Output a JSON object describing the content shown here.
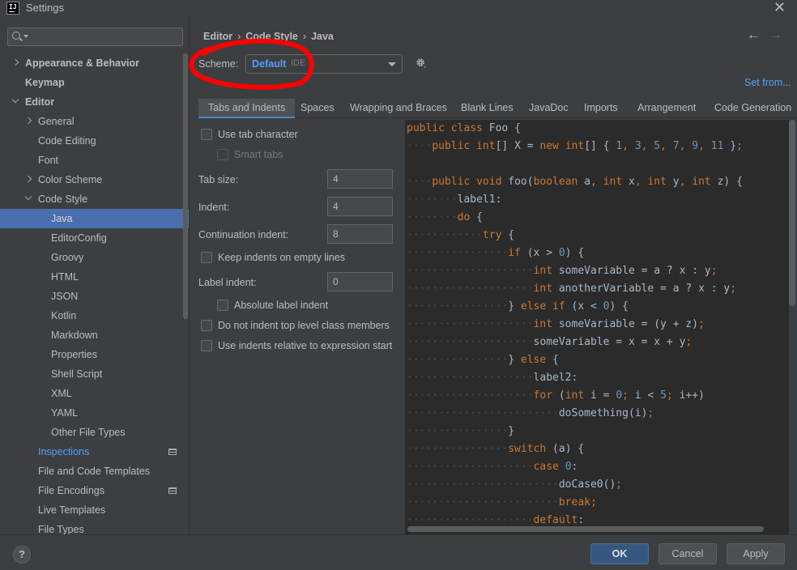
{
  "window": {
    "title": "Settings",
    "app_icon_text": "IJ"
  },
  "sidebar": {
    "search_placeholder": "",
    "items": [
      {
        "label": "Appearance & Behavior",
        "level": 0,
        "expand": "collapsed",
        "bold": true
      },
      {
        "label": "Keymap",
        "level": 0,
        "expand": "none",
        "bold": true
      },
      {
        "label": "Editor",
        "level": 0,
        "expand": "expanded",
        "bold": true
      },
      {
        "label": "General",
        "level": 1,
        "expand": "collapsed"
      },
      {
        "label": "Code Editing",
        "level": 1,
        "expand": "none"
      },
      {
        "label": "Font",
        "level": 1,
        "expand": "none"
      },
      {
        "label": "Color Scheme",
        "level": 1,
        "expand": "collapsed"
      },
      {
        "label": "Code Style",
        "level": 1,
        "expand": "expanded"
      },
      {
        "label": "Java",
        "level": 2,
        "expand": "none",
        "selected": true
      },
      {
        "label": "EditorConfig",
        "level": 2,
        "expand": "none"
      },
      {
        "label": "Groovy",
        "level": 2,
        "expand": "none"
      },
      {
        "label": "HTML",
        "level": 2,
        "expand": "none"
      },
      {
        "label": "JSON",
        "level": 2,
        "expand": "none"
      },
      {
        "label": "Kotlin",
        "level": 2,
        "expand": "none"
      },
      {
        "label": "Markdown",
        "level": 2,
        "expand": "none"
      },
      {
        "label": "Properties",
        "level": 2,
        "expand": "none"
      },
      {
        "label": "Shell Script",
        "level": 2,
        "expand": "none"
      },
      {
        "label": "XML",
        "level": 2,
        "expand": "none"
      },
      {
        "label": "YAML",
        "level": 2,
        "expand": "none"
      },
      {
        "label": "Other File Types",
        "level": 2,
        "expand": "none"
      },
      {
        "label": "Inspections",
        "level": 1,
        "expand": "none",
        "link": true,
        "project_icon": true
      },
      {
        "label": "File and Code Templates",
        "level": 1,
        "expand": "none"
      },
      {
        "label": "File Encodings",
        "level": 1,
        "expand": "none",
        "project_icon": true
      },
      {
        "label": "Live Templates",
        "level": 1,
        "expand": "none"
      },
      {
        "label": "File Types",
        "level": 1,
        "expand": "none"
      }
    ]
  },
  "header": {
    "breadcrumb": [
      "Editor",
      "Code Style",
      "Java"
    ],
    "scheme_label": "Scheme:",
    "scheme_value": "Default",
    "scheme_suffix": "IDE",
    "set_from": "Set from..."
  },
  "tabs": [
    "Tabs and Indents",
    "Spaces",
    "Wrapping and Braces",
    "Blank Lines",
    "JavaDoc",
    "Imports",
    "Arrangement",
    "Code Generation"
  ],
  "options": {
    "use_tab_character": "Use tab character",
    "smart_tabs": "Smart tabs",
    "tab_size_label": "Tab size:",
    "tab_size": "4",
    "indent_label": "Indent:",
    "indent": "4",
    "continuation_indent_label": "Continuation indent:",
    "continuation_indent": "8",
    "keep_indents": "Keep indents on empty lines",
    "label_indent_label": "Label indent:",
    "label_indent": "0",
    "absolute_label_indent": "Absolute label indent",
    "no_indent_top_level": "Do not indent top level class members",
    "relative_indents": "Use indents relative to expression start"
  },
  "code_lines": [
    "public class Foo {",
    "    public int[] X = new int[] { 1, 3, 5, 7, 9, 11 };",
    "",
    "    public void foo(boolean a, int x, int y, int z) {",
    "        label1:",
    "        do {",
    "            try {",
    "                if (x > 0) {",
    "                    int someVariable = a ? x : y;",
    "                    int anotherVariable = a ? x : y;",
    "                } else if (x < 0) {",
    "                    int someVariable = (y + z);",
    "                    someVariable = x = x + y;",
    "                } else {",
    "                    label2:",
    "                    for (int i = 0; i < 5; i++)",
    "                        doSomething(i);",
    "                }",
    "                switch (a) {",
    "                    case 0:",
    "                        doCase0();",
    "                        break;",
    "                    default:"
  ],
  "footer": {
    "help": "?",
    "ok": "OK",
    "cancel": "Cancel",
    "apply": "Apply"
  },
  "colors": {
    "accent": "#4b6eaf",
    "link": "#589df6",
    "keyword": "#cc7832",
    "number": "#6897bb",
    "annotation_circle": "#ff0000"
  }
}
